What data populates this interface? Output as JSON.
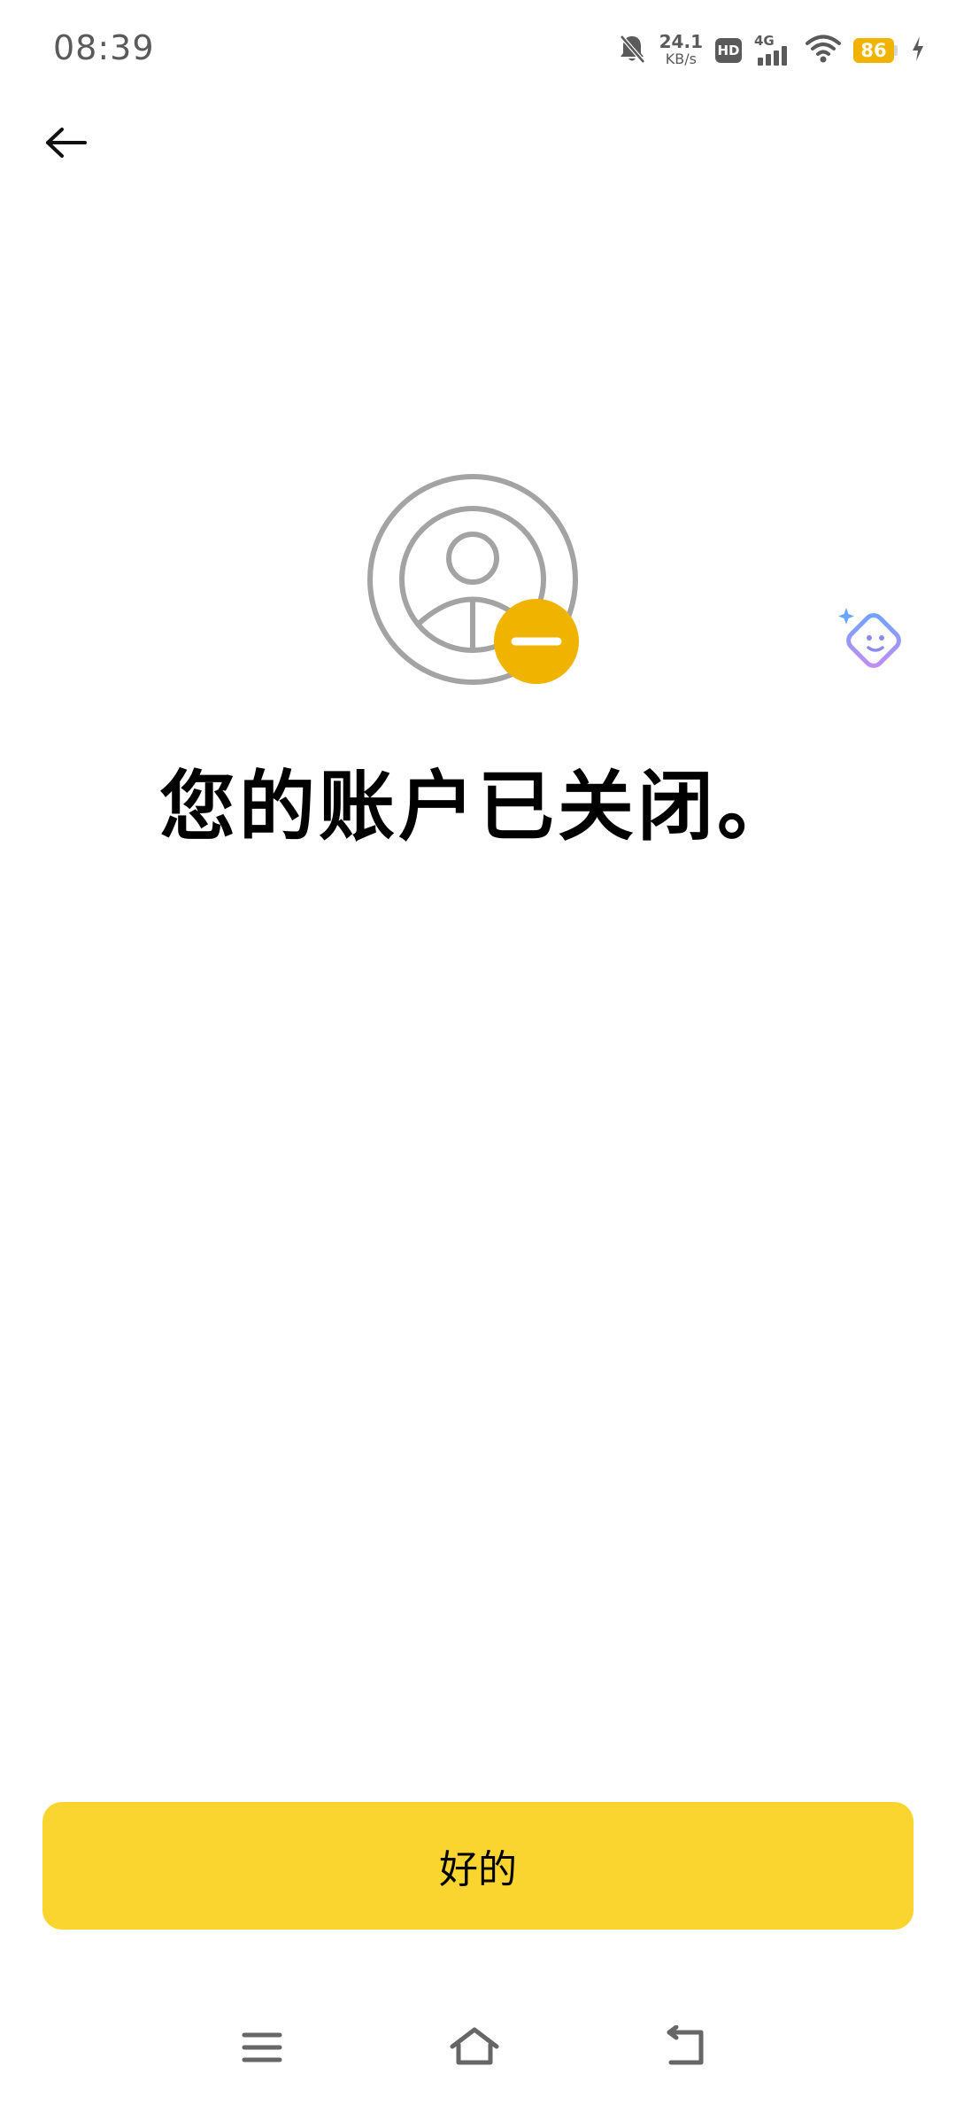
{
  "status_bar": {
    "time": "08:39",
    "net_speed_value": "24.1",
    "net_speed_unit": "KB/s",
    "hd_label": "HD",
    "network_type": "4G",
    "battery_level": "86",
    "icons": [
      "mute-bell-icon",
      "hd-icon",
      "signal-icon",
      "wifi-icon",
      "battery-icon",
      "charging-icon"
    ]
  },
  "header": {
    "back_icon": "arrow-left-icon"
  },
  "main": {
    "illustration_icon": "account-closed-icon",
    "title": "您的账户已关闭。",
    "assistant_icon": "assistant-sparkle-icon"
  },
  "footer": {
    "ok_label": "好的"
  },
  "nav_bar": {
    "icons": [
      "menu-icon",
      "home-icon",
      "back-nav-icon"
    ]
  },
  "colors": {
    "accent": "#fbd52f",
    "badge": "#f0b400",
    "icon_gray": "#a3a3a3",
    "status_gray": "#5a5a5a"
  }
}
